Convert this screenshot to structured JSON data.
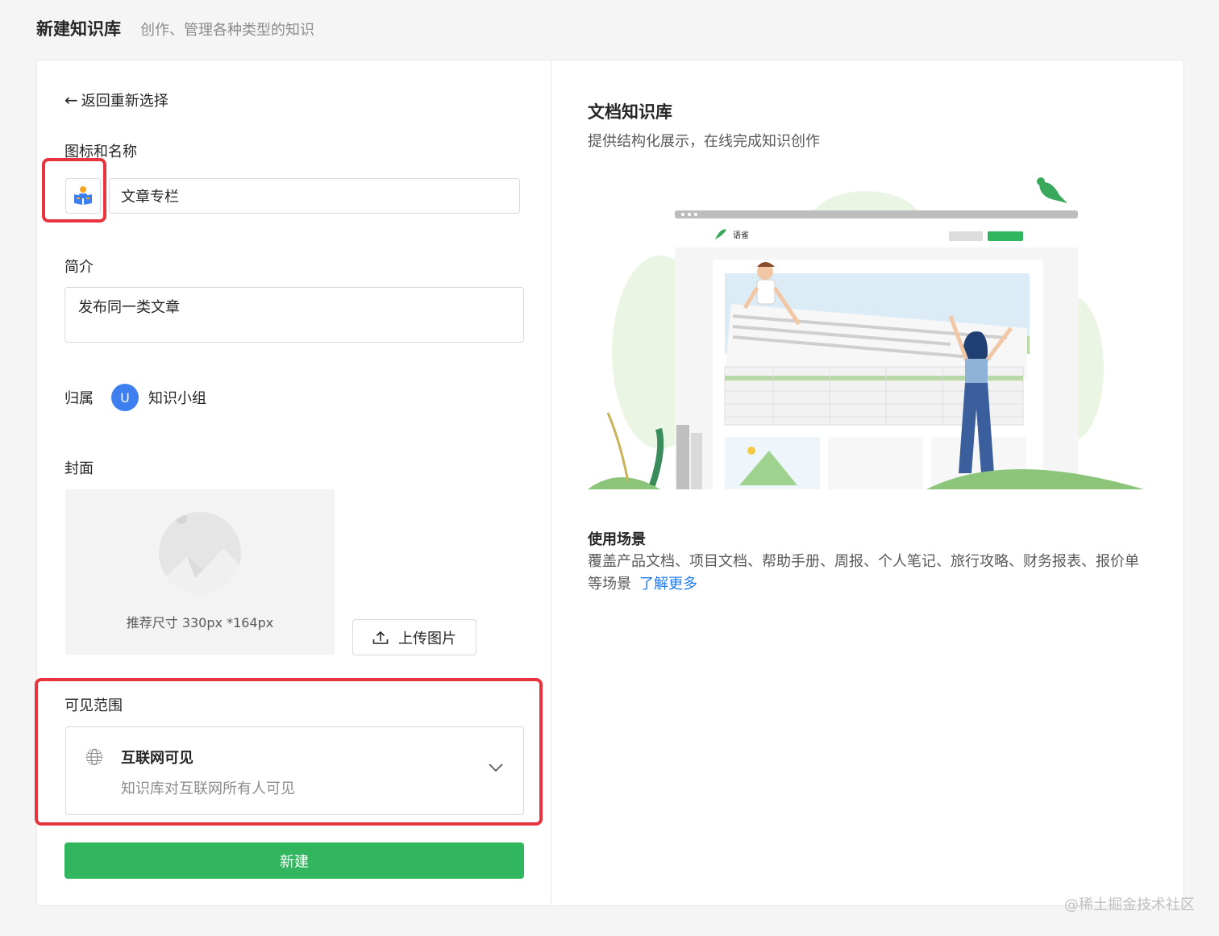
{
  "header": {
    "title": "新建知识库",
    "subtitle": "创作、管理各种类型的知识"
  },
  "form": {
    "back_label": "返回重新选择",
    "icon_name_label": "图标和名称",
    "name_value": "文章专栏",
    "desc_label": "简介",
    "desc_value": "发布同一类文章",
    "owner_label": "归属",
    "owner_avatar": "U",
    "owner_name": "知识小组",
    "cover_label": "封面",
    "cover_hint": "推荐尺寸 330px *164px",
    "upload_label": "上传图片",
    "visibility_label": "可见范围",
    "visibility_title": "互联网可见",
    "visibility_desc": "知识库对互联网所有人可见",
    "submit_label": "新建"
  },
  "preview": {
    "title": "文档知识库",
    "desc": "提供结构化展示，在线完成知识创作",
    "app_brand": "语雀",
    "usage_title": "使用场景",
    "usage_text": "覆盖产品文档、项目文档、帮助手册、周报、个人笔记、旅行攻略、财务报表、报价单等场景",
    "learn_more": "了解更多"
  },
  "watermark": "@稀土掘金技术社区",
  "colors": {
    "primary_green": "#31b55f",
    "link_blue": "#1f7bf0",
    "highlight_red": "#e8343f",
    "avatar_blue": "#3e7ff0"
  },
  "icons": [
    "back-arrow-icon",
    "reader-icon",
    "upload-icon",
    "globe-icon",
    "chevron-down-icon",
    "image-placeholder-icon"
  ]
}
